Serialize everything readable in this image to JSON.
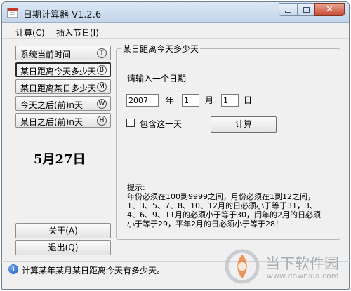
{
  "window": {
    "title": "日期计算器 V1.2.6"
  },
  "menu": {
    "items": [
      "计算(C)",
      "插入节日(I)"
    ]
  },
  "nav": {
    "items": [
      {
        "label": "系统当前时间",
        "key": "T"
      },
      {
        "label": "某日距离今天多少天",
        "key": "B"
      },
      {
        "label": "某日距离某日多少天",
        "key": "M"
      },
      {
        "label": "今天之后(前)n天",
        "key": "W"
      },
      {
        "label": "某日之后(前)n天",
        "key": "H"
      }
    ],
    "active_index": 1
  },
  "date_display": "5月27日",
  "buttons": {
    "about": "关于(A)",
    "exit": "退出(Q)",
    "calculate": "计算"
  },
  "group": {
    "title": "某日距离今天多少天",
    "prompt": "请输入一个日期",
    "year_value": "2007",
    "year_unit": "年",
    "month_value": "1",
    "month_unit": "月",
    "day_value": "1",
    "day_unit": "日",
    "include_day_label": "包含这一天",
    "include_day_checked": false
  },
  "tip": {
    "heading": "提示:",
    "body": "年份必须在100到9999之间，月份必须在1到12之间，1、3、5、7、8、10、12月的日必须小于等于31，3、4、6、9、11月的必须小于等于30，闰年的2月的日必须小于等于29，平年2月的日必须小于等于28！"
  },
  "status": {
    "text": "计算某年某月某日距离今天有多少天。",
    "icon": "info-icon"
  },
  "watermark": {
    "name": "当下软件园",
    "url": "www.downxia.com"
  },
  "colors": {
    "title_gradient_top": "#dbe7f4",
    "close_button": "#c74a32",
    "info_icon": "#1f5fbf",
    "watermark_orange": "#e8742a"
  }
}
